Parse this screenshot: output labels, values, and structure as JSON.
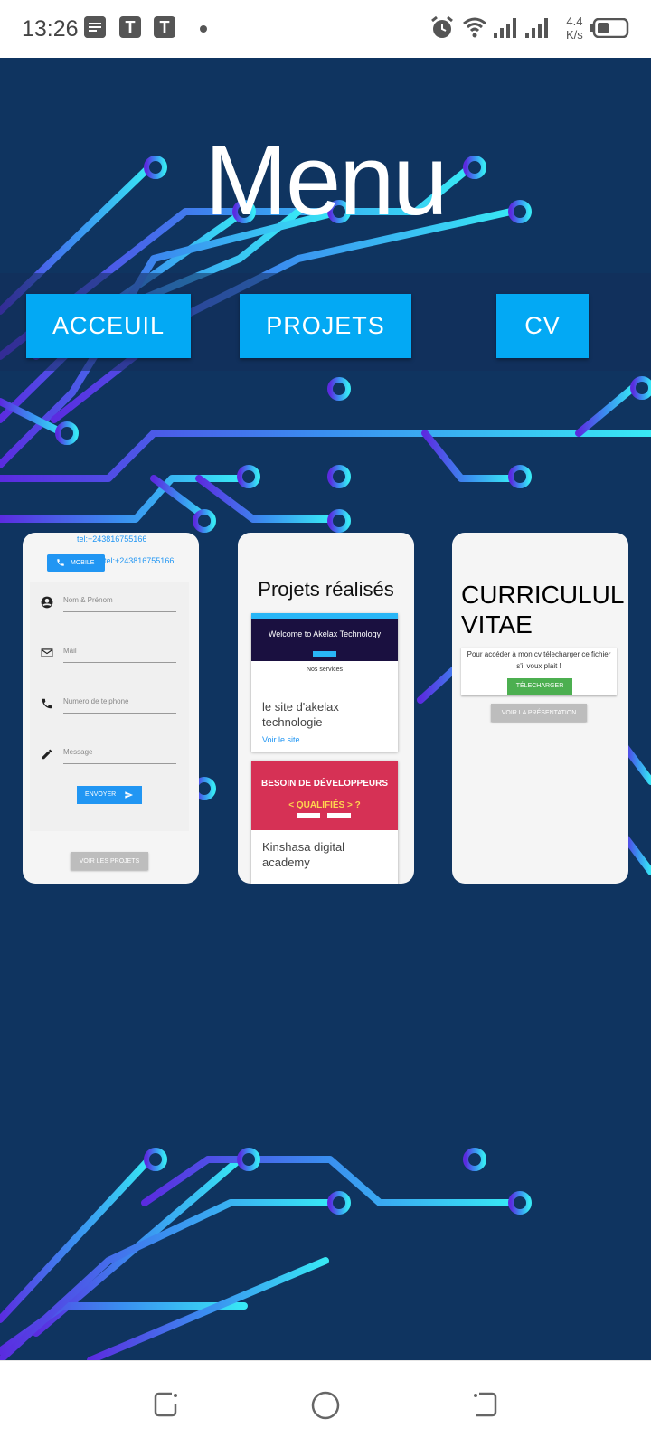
{
  "status_bar": {
    "time": "13:26",
    "notification_icons": [
      "notes-icon",
      "t-app-icon",
      "t-app-icon",
      "dot-icon"
    ],
    "t_letter": "T",
    "speed_value": "4.4",
    "speed_unit": "K/s",
    "right_icons": [
      "alarm-icon",
      "wifi-icon",
      "signal-icon",
      "signal-icon",
      "battery-icon"
    ]
  },
  "header": {
    "title": "Menu"
  },
  "nav": {
    "home_label": "ACCEUIL",
    "projects_label": "PROJETS",
    "cv_label": "CV"
  },
  "contact_card": {
    "tel_1": "tel:+243816755166",
    "tel_2": "tel:+243816755166",
    "mobile_label": "MOBILE",
    "fields": {
      "name_placeholder": "Nom & Prénom",
      "mail_placeholder": "Mail",
      "phone_placeholder": "Numero de telphone",
      "message_placeholder": "Message"
    },
    "send_label": "ENVOYER",
    "view_projects_label": "VOIR LES PROJETS"
  },
  "projects_card": {
    "title": "Projets réalisés",
    "projects": [
      {
        "thumb_title": "Welcome to Akelax Technology",
        "thumb_subtitle": "Nos services",
        "name": "le site d'akelax technologie",
        "link_label": "Voir le site"
      },
      {
        "thumb_title": "BESOIN DE DÉVELOPPEURS",
        "thumb_subtitle": "< QUALIFIÉS > ?",
        "name": "Kinshasa digital academy"
      }
    ]
  },
  "cv_card": {
    "title": "CURRICULUL VITAE",
    "description": "Pour accéder à mon cv télecharger ce fichier s'il voux plait !",
    "download_label": "TÉLECHARGER",
    "presentation_label": "VOIR LA PRÉSENTATION"
  },
  "colors": {
    "background": "#0f3460",
    "accent": "#03a9f4",
    "button_blue": "#2196f3",
    "download_green": "#4caf50",
    "circuit_purple": "#5b2be0",
    "circuit_cyan": "#38e8f5"
  }
}
